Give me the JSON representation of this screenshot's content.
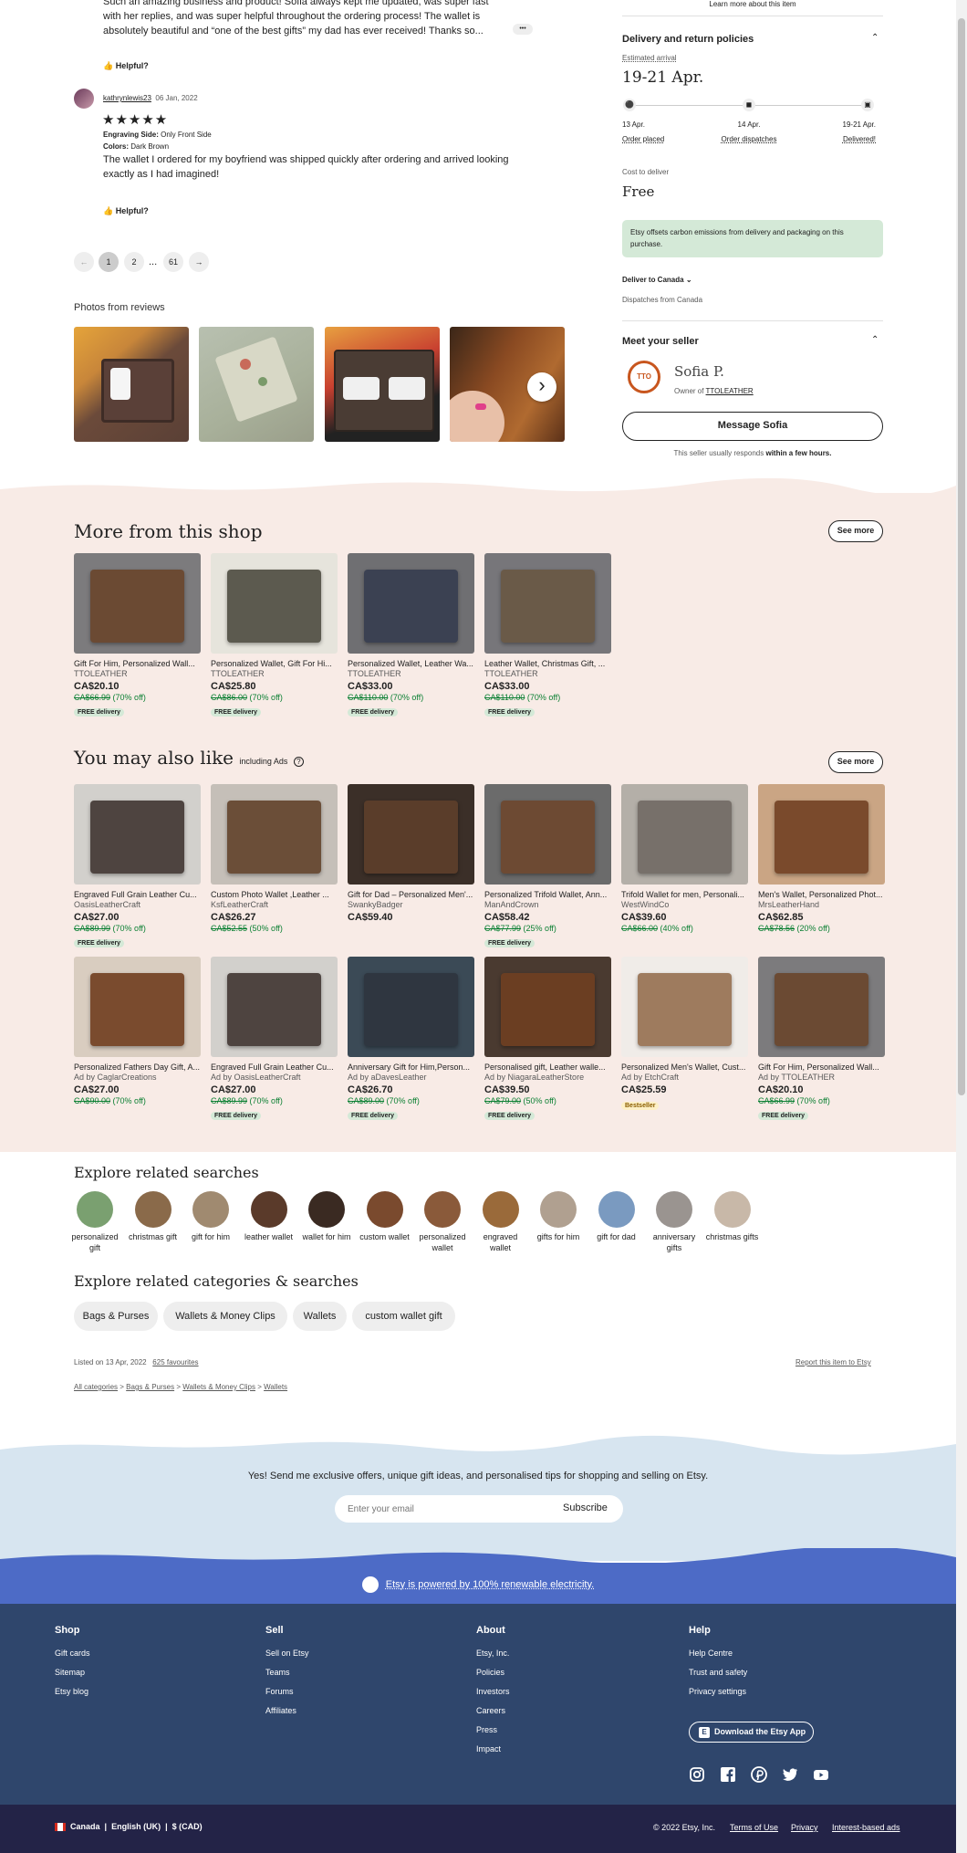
{
  "review_top": {
    "text": "Such an amazing business and product! Sofia always kept me updated, was super fast with her replies, and was super helpful throughout the ordering process! The wallet is absolutely beautiful and “one of the best gifts” my dad has ever received! Thanks so...",
    "more": "•••",
    "helpful": "Helpful?"
  },
  "review2": {
    "user": "kathrynlewis23",
    "date": "06 Jan, 2022",
    "stars": "★★★★★",
    "eng_label": "Engraving Side:",
    "eng_value": "Only Front Side",
    "col_label": "Colors:",
    "col_value": "Dark Brown",
    "text": "The wallet I ordered for my boyfriend was shipped quickly after ordering and arrived looking exactly as I had imagined!",
    "helpful": "Helpful?"
  },
  "pagination": {
    "prev": "←",
    "p1": "1",
    "p2": "2",
    "dots": "...",
    "last": "61",
    "next": "→"
  },
  "photos_title": "Photos from reviews",
  "next_arrow": "›",
  "right": {
    "learn_more": "Learn more about this item",
    "delivery_title": "Delivery and return policies",
    "est_label": "Estimated arrival",
    "est_value": "19-21 Apr.",
    "steps": [
      {
        "date": "13 Apr.",
        "label": "Order placed"
      },
      {
        "date": "14 Apr.",
        "label": "Order dispatches"
      },
      {
        "date": "19-21 Apr.",
        "label": "Delivered!"
      }
    ],
    "cost_label": "Cost to deliver",
    "cost_value": "Free",
    "carbon": "Etsy offsets carbon emissions from delivery and packaging on this purchase.",
    "deliver_to": "Deliver to Canada",
    "dispatch_from": "Dispatches from Canada",
    "seller_title": "Meet your seller",
    "seller_name": "Sofia P.",
    "owner_prefix": "Owner of",
    "shop_name": "TTOLEATHER",
    "logo_text": "TTO",
    "message_btn": "Message Sofia",
    "responds_prefix": "This seller usually responds",
    "responds_bold": "within a few hours."
  },
  "more_shop": {
    "title": "More from this shop",
    "see_more": "See more",
    "items": [
      {
        "title": "Gift For Him, Personalized Wall...",
        "shop": "TTOLEATHER",
        "price": "CA$20.10",
        "orig": "CA$66.99",
        "off": "(70% off)",
        "badge": "FREE delivery",
        "color": "#6b4a33",
        "bg": "#7c7b7d"
      },
      {
        "title": "Personalized Wallet, Gift For Hi...",
        "shop": "TTOLEATHER",
        "price": "CA$25.80",
        "orig": "CA$86.00",
        "off": "(70% off)",
        "badge": "FREE delivery",
        "color": "#5c5a4f",
        "bg": "#e6e4dc"
      },
      {
        "title": "Personalized Wallet, Leather Wa...",
        "shop": "TTOLEATHER",
        "price": "CA$33.00",
        "orig": "CA$110.00",
        "off": "(70% off)",
        "badge": "FREE delivery",
        "color": "#3b4152",
        "bg": "#6f6f72"
      },
      {
        "title": "Leather Wallet, Christmas Gift, ...",
        "shop": "TTOLEATHER",
        "price": "CA$33.00",
        "orig": "CA$110.00",
        "off": "(70% off)",
        "badge": "FREE delivery",
        "color": "#6a5a48",
        "bg": "#77767a"
      }
    ]
  },
  "also_like": {
    "title": "You may also like",
    "ads": "including Ads",
    "help_icon": "?",
    "see_more": "See more",
    "row1": [
      {
        "title": "Engraved Full Grain Leather Cu...",
        "shop": "OasisLeatherCraft",
        "price": "CA$27.00",
        "orig": "CA$89.99",
        "off": "(70% off)",
        "badge": "FREE delivery",
        "color": "#4e4440",
        "bg": "#d2d0cc"
      },
      {
        "title": "Custom Photo Wallet ,Leather ...",
        "shop": "KsfLeatherCraft",
        "price": "CA$26.27",
        "orig": "CA$52.55",
        "off": "(50% off)",
        "badge": "",
        "color": "#6b4e38",
        "bg": "#c5bfb8"
      },
      {
        "title": "Gift for Dad – Personalized Men'...",
        "shop": "SwankyBadger",
        "price": "CA$59.40",
        "orig": "",
        "off": "",
        "badge": "",
        "color": "#5a3d2a",
        "bg": "#3b2f28"
      },
      {
        "title": "Personalized Trifold Wallet, Ann...",
        "shop": "ManAndCrown",
        "price": "CA$58.42",
        "orig": "CA$77.99",
        "off": "(25% off)",
        "badge": "FREE delivery",
        "color": "#6d4a33",
        "bg": "#6b6b6b"
      },
      {
        "title": "Trifold Wallet for men, Personali...",
        "shop": "WestWindCo",
        "price": "CA$39.60",
        "orig": "CA$66.00",
        "off": "(40% off)",
        "badge": "",
        "color": "#77706a",
        "bg": "#b4afa8"
      },
      {
        "title": "Men's Wallet, Personalized Phot...",
        "shop": "MrsLeatherHand",
        "price": "CA$62.85",
        "orig": "CA$78.56",
        "off": "(20% off)",
        "badge": "",
        "color": "#7a4a2c",
        "bg": "#caa584"
      }
    ],
    "row2": [
      {
        "title": "Personalized Fathers Day Gift, A...",
        "shop": "Ad by CaglarCreations",
        "price": "CA$27.00",
        "orig": "CA$90.00",
        "off": "(70% off)",
        "badge": "",
        "color": "#7a4b2e",
        "bg": "#d9cdc0"
      },
      {
        "title": "Engraved Full Grain Leather Cu...",
        "shop": "Ad by OasisLeatherCraft",
        "price": "CA$27.00",
        "orig": "CA$89.99",
        "off": "(70% off)",
        "badge": "FREE delivery",
        "color": "#4e4440",
        "bg": "#d2d0cc"
      },
      {
        "title": "Anniversary Gift for Him,Person...",
        "shop": "Ad by aDavesLeather",
        "price": "CA$26.70",
        "orig": "CA$89.00",
        "off": "(70% off)",
        "badge": "FREE delivery",
        "color": "#2f3640",
        "bg": "#3b4a56"
      },
      {
        "title": "Personalised gift, Leather walle...",
        "shop": "Ad by NiagaraLeatherStore",
        "price": "CA$39.50",
        "orig": "CA$79.00",
        "off": "(50% off)",
        "badge": "FREE delivery",
        "color": "#6b3e22",
        "bg": "#4a3a30"
      },
      {
        "title": "Personalized Men's Wallet, Cust...",
        "shop": "Ad by EtchCraft",
        "price": "CA$25.59",
        "orig": "",
        "off": "",
        "badge": "",
        "best": "Bestseller",
        "color": "#9e7b5e",
        "bg": "#f0ece8"
      },
      {
        "title": "Gift For Him, Personalized Wall...",
        "shop": "Ad by TTOLEATHER",
        "price": "CA$20.10",
        "orig": "CA$66.99",
        "off": "(70% off)",
        "badge": "FREE delivery",
        "color": "#6b4a33",
        "bg": "#7c7b7d"
      }
    ]
  },
  "related": {
    "title": "Explore related searches",
    "items": [
      {
        "label": "personalized gift",
        "c": "#7aa070"
      },
      {
        "label": "christmas gift",
        "c": "#8a6a4a"
      },
      {
        "label": "gift for him",
        "c": "#a08a70"
      },
      {
        "label": "leather wallet",
        "c": "#5a3a2a"
      },
      {
        "label": "wallet for him",
        "c": "#3a2a22"
      },
      {
        "label": "custom wallet",
        "c": "#7a4a2e"
      },
      {
        "label": "personalized wallet",
        "c": "#8a5a3a"
      },
      {
        "label": "engraved wallet",
        "c": "#9a6a3a"
      },
      {
        "label": "gifts for him",
        "c": "#b0a090"
      },
      {
        "label": "gift for dad",
        "c": "#7a9ac0"
      },
      {
        "label": "anniversary gifts",
        "c": "#9a9490"
      },
      {
        "label": "christmas gifts",
        "c": "#c8b8a8"
      }
    ]
  },
  "categories": {
    "title": "Explore related categories & searches",
    "items": [
      "Bags & Purses",
      "Wallets & Money Clips",
      "Wallets",
      "custom wallet gift"
    ]
  },
  "listing": {
    "listed": "Listed on 13 Apr, 2022",
    "favs": "625 favourites",
    "report": "Report this item to Etsy",
    "crumbs": [
      "All categories",
      "Bags & Purses",
      "Wallets & Money Clips",
      "Wallets"
    ],
    "sep": ">"
  },
  "newsletter": {
    "text": "Yes! Send me exclusive offers, unique gift ideas, and personalised tips for shopping and selling on Etsy.",
    "placeholder": "Enter your email",
    "button": "Subscribe"
  },
  "renewable": "Etsy is powered by 100% renewable electricity.",
  "footer": {
    "cols": [
      {
        "title": "Shop",
        "items": [
          "Gift cards",
          "Sitemap",
          "Etsy blog"
        ]
      },
      {
        "title": "Sell",
        "items": [
          "Sell on Etsy",
          "Teams",
          "Forums",
          "Affiliates"
        ]
      },
      {
        "title": "About",
        "items": [
          "Etsy, Inc.",
          "Policies",
          "Investors",
          "Careers",
          "Press",
          "Impact"
        ]
      },
      {
        "title": "Help",
        "items": [
          "Help Centre",
          "Trust and safety",
          "Privacy settings"
        ]
      }
    ],
    "app_btn": "Download the Etsy App",
    "app_icon": "E"
  },
  "bottom": {
    "country": "Canada",
    "lang": "English (UK)",
    "currency": "$ (CAD)",
    "sep": "|",
    "copyright": "© 2022 Etsy, Inc.",
    "links": [
      "Terms of Use",
      "Privacy",
      "Interest-based ads"
    ]
  },
  "colors": {
    "pink": "#f8ebe6",
    "blue_light": "#d7e5f0",
    "blue_band": "#4d6bc6",
    "navy": "#232347",
    "footer": "#2f466c",
    "green_badge": "#d4e9d7"
  }
}
